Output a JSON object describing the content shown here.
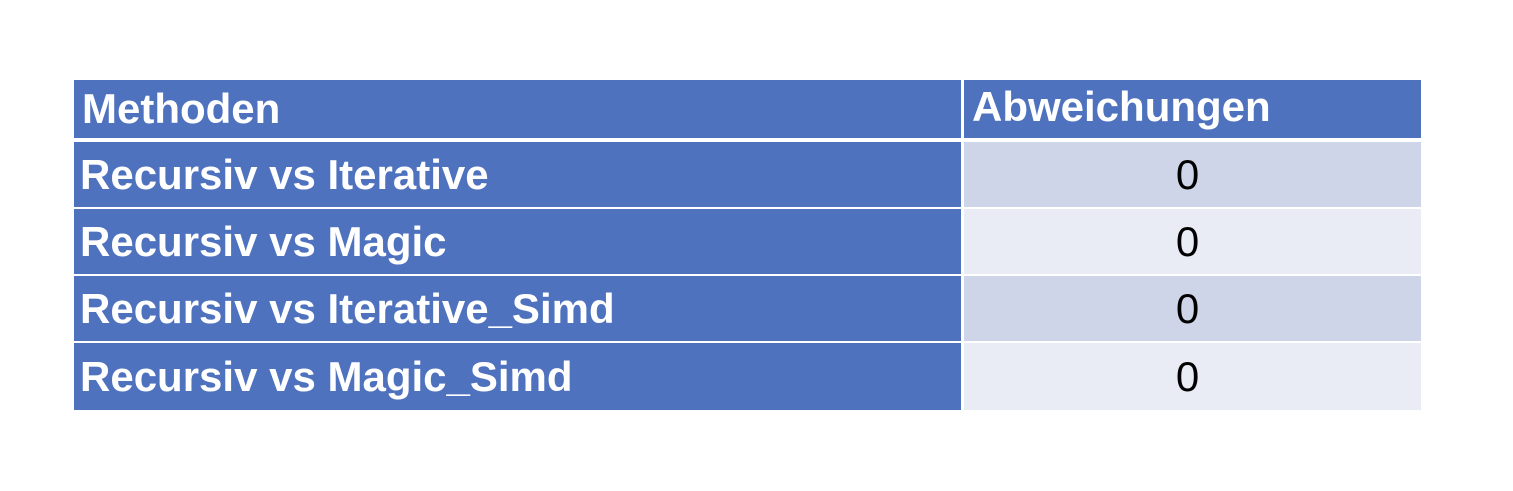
{
  "table": {
    "headers": {
      "method": "Methoden",
      "deviations": "Abweichungen"
    },
    "rows": [
      {
        "method": "Recursiv vs Iterative",
        "value": "0"
      },
      {
        "method": "Recursiv vs Magic",
        "value": "0"
      },
      {
        "method": "Recursiv vs Iterative_Simd",
        "value": "0"
      },
      {
        "method": "Recursiv vs Magic_Simd",
        "value": "0"
      }
    ]
  },
  "colors": {
    "header_bg": "#4f72bf",
    "row_odd_bg": "#cfd5e8",
    "row_even_bg": "#e9ebf5",
    "header_text": "#ffffff",
    "value_text": "#000000"
  }
}
